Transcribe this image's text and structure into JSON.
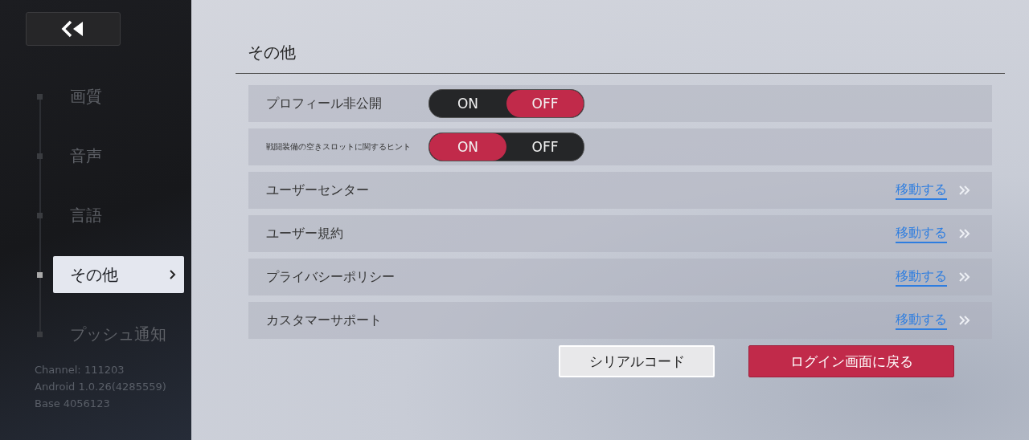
{
  "sidebar": {
    "items": [
      {
        "label": "画質",
        "selected": false
      },
      {
        "label": "音声",
        "selected": false
      },
      {
        "label": "言語",
        "selected": false
      },
      {
        "label": "その他",
        "selected": true
      },
      {
        "label": "プッシュ通知",
        "selected": false
      }
    ],
    "version_info": [
      "Channel: 111203",
      "Android 1.0.26(4285559)",
      "Base 4056123"
    ]
  },
  "section": {
    "title": "その他",
    "rows": [
      {
        "kind": "toggle",
        "label": "プロフィール非公開",
        "small": false,
        "on": false,
        "on_label": "ON",
        "off_label": "OFF"
      },
      {
        "kind": "toggle",
        "label": "戦闘装備の空きスロットに関するヒント",
        "small": true,
        "on": true,
        "on_label": "ON",
        "off_label": "OFF"
      },
      {
        "kind": "link",
        "label": "ユーザーセンター",
        "link": "移動する"
      },
      {
        "kind": "link",
        "label": "ユーザー規約",
        "link": "移動する"
      },
      {
        "kind": "link",
        "label": "プライバシーポリシー",
        "link": "移動する"
      },
      {
        "kind": "link",
        "label": "カスタマーサポート",
        "link": "移動する"
      }
    ]
  },
  "buttons": [
    {
      "label": "シリアルコード",
      "kind": "secondary"
    },
    {
      "label": "ログイン画面に戻る",
      "kind": "primary"
    }
  ]
}
